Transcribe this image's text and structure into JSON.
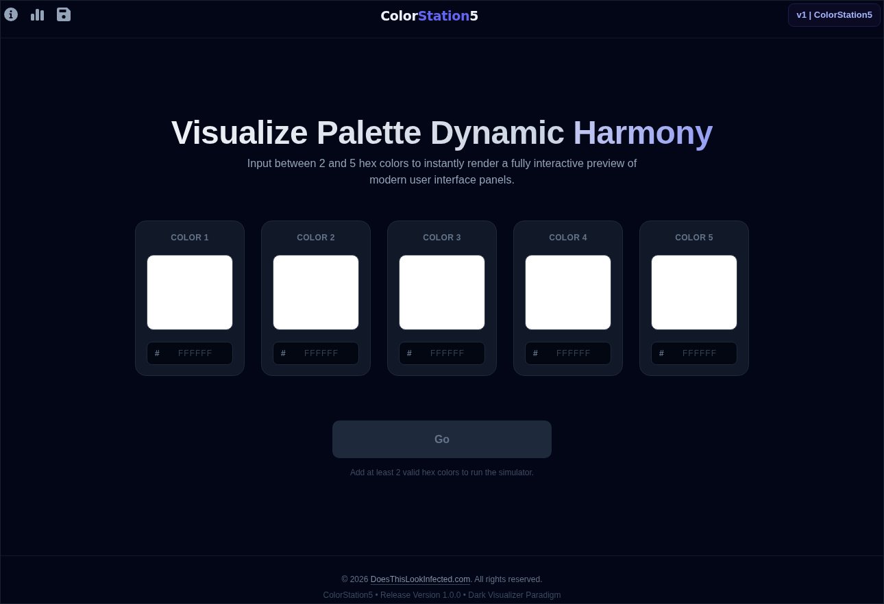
{
  "header": {
    "logo": [
      {
        "text": "Color",
        "accent": false
      },
      {
        "text": "Station",
        "accent": true
      },
      {
        "text": "5",
        "accent": false
      }
    ],
    "version_badge": "v1 | ColorStation5"
  },
  "hero": {
    "title": "Visualize Palette Dynamic",
    "title_accent": "Harmony",
    "subtitle": "Input between 2 and 5 hex colors to instantly render a fully interactive preview of modern user interface panels."
  },
  "color_slots": [
    {
      "label": "COLOR 1",
      "color": "#ffffff",
      "prefix": "#",
      "placeholder": "FFFFFF"
    },
    {
      "label": "COLOR 2",
      "color": "#ffffff",
      "prefix": "#",
      "placeholder": "FFFFFF"
    },
    {
      "label": "COLOR 3",
      "color": "#ffffff",
      "prefix": "#",
      "placeholder": "FFFFFF"
    },
    {
      "label": "COLOR 4",
      "color": "#ffffff",
      "prefix": "#",
      "placeholder": "FFFFFF"
    },
    {
      "label": "COLOR 5",
      "color": "#ffffff",
      "prefix": "#",
      "placeholder": "FFFFFF"
    }
  ],
  "go_button": {
    "label": "Go",
    "disabled": true
  },
  "hint": "Add at least 2 valid hex colors to run the simulator.",
  "footer": {
    "copyright_before": "© 2026",
    "link": "DoesThisLookInfected.com",
    "copyright_after": ". All rights reserved.",
    "release_line": "ColorStation5 • Release Version 1.0.0 • Dark Visualizer Paradigm"
  }
}
